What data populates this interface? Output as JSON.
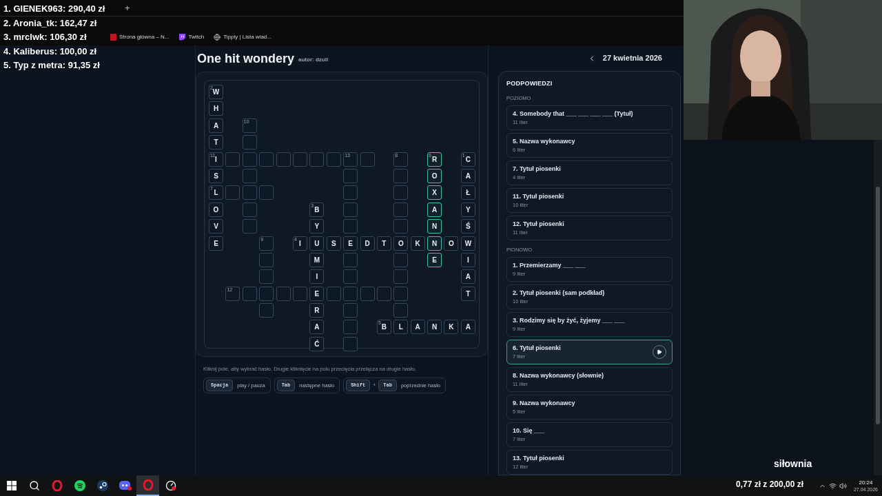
{
  "overlay_leaderboard": [
    "1. GIENEK963: 290,40 zł",
    "2. Aronia_tk: 162,47 zł",
    "3. mrclwk: 106,30 zł",
    "4. Kaliberus: 100,00 zł",
    "5. Typ z metra: 91,35 zł"
  ],
  "browser": {
    "new_tab": "+",
    "bookmarks": [
      {
        "kind": "site",
        "label": "Strona główna – N..."
      },
      {
        "kind": "twitch",
        "label": "Twitch"
      },
      {
        "kind": "tip",
        "label": "Tipply | Lista wiad..."
      }
    ]
  },
  "page": {
    "title": "One hit wondery",
    "author": "autor: dzuli",
    "date": "27 kwietnia 2026"
  },
  "board": {
    "grid": [
      [
        {
          "kind": "cell",
          "letter": "W",
          "number": "2",
          "highlighted": false
        },
        {
          "kind": "none"
        },
        {
          "kind": "none"
        },
        {
          "kind": "none"
        },
        {
          "kind": "none"
        },
        {
          "kind": "none"
        },
        {
          "kind": "none"
        },
        {
          "kind": "none"
        },
        {
          "kind": "none"
        },
        {
          "kind": "none"
        },
        {
          "kind": "none"
        },
        {
          "kind": "none"
        },
        {
          "kind": "none"
        },
        {
          "kind": "none"
        },
        {
          "kind": "none"
        },
        {
          "kind": "none"
        }
      ],
      [
        {
          "kind": "cell",
          "letter": "H",
          "highlighted": false
        },
        {
          "kind": "none"
        },
        {
          "kind": "none"
        },
        {
          "kind": "none"
        },
        {
          "kind": "none"
        },
        {
          "kind": "none"
        },
        {
          "kind": "none"
        },
        {
          "kind": "none"
        },
        {
          "kind": "none"
        },
        {
          "kind": "none"
        },
        {
          "kind": "none"
        },
        {
          "kind": "none"
        },
        {
          "kind": "none"
        },
        {
          "kind": "none"
        },
        {
          "kind": "none"
        },
        {
          "kind": "none"
        }
      ],
      [
        {
          "kind": "cell",
          "letter": "A",
          "highlighted": false
        },
        {
          "kind": "none"
        },
        {
          "kind": "cell",
          "number": "10",
          "highlighted": false
        },
        {
          "kind": "none"
        },
        {
          "kind": "none"
        },
        {
          "kind": "none"
        },
        {
          "kind": "none"
        },
        {
          "kind": "none"
        },
        {
          "kind": "none"
        },
        {
          "kind": "none"
        },
        {
          "kind": "none"
        },
        {
          "kind": "none"
        },
        {
          "kind": "none"
        },
        {
          "kind": "none"
        },
        {
          "kind": "none"
        },
        {
          "kind": "none"
        }
      ],
      [
        {
          "kind": "cell",
          "letter": "T",
          "highlighted": false
        },
        {
          "kind": "none"
        },
        {
          "kind": "cell",
          "highlighted": false
        },
        {
          "kind": "none"
        },
        {
          "kind": "none"
        },
        {
          "kind": "none"
        },
        {
          "kind": "none"
        },
        {
          "kind": "none"
        },
        {
          "kind": "none"
        },
        {
          "kind": "none"
        },
        {
          "kind": "none"
        },
        {
          "kind": "none"
        },
        {
          "kind": "none"
        },
        {
          "kind": "none"
        },
        {
          "kind": "none"
        },
        {
          "kind": "none"
        }
      ],
      [
        {
          "kind": "cell",
          "letter": "I",
          "number": "11",
          "highlighted": false
        },
        {
          "kind": "cell",
          "highlighted": false
        },
        {
          "kind": "cell",
          "highlighted": false
        },
        {
          "kind": "cell",
          "highlighted": false
        },
        {
          "kind": "cell",
          "highlighted": false
        },
        {
          "kind": "cell",
          "highlighted": false
        },
        {
          "kind": "cell",
          "highlighted": false
        },
        {
          "kind": "cell",
          "highlighted": false
        },
        {
          "kind": "cell",
          "number": "13",
          "highlighted": false
        },
        {
          "kind": "cell",
          "highlighted": false
        },
        {
          "kind": "none"
        },
        {
          "kind": "cell",
          "number": "8",
          "highlighted": false
        },
        {
          "kind": "none"
        },
        {
          "kind": "cell",
          "letter": "R",
          "number": "6",
          "highlighted": true
        },
        {
          "kind": "none"
        },
        {
          "kind": "cell",
          "letter": "C",
          "number": "1",
          "highlighted": false
        }
      ],
      [
        {
          "kind": "cell",
          "letter": "S",
          "highlighted": false
        },
        {
          "kind": "none"
        },
        {
          "kind": "cell",
          "highlighted": false
        },
        {
          "kind": "none"
        },
        {
          "kind": "none"
        },
        {
          "kind": "none"
        },
        {
          "kind": "none"
        },
        {
          "kind": "none"
        },
        {
          "kind": "cell",
          "highlighted": false
        },
        {
          "kind": "none"
        },
        {
          "kind": "none"
        },
        {
          "kind": "cell",
          "highlighted": false
        },
        {
          "kind": "none"
        },
        {
          "kind": "cell",
          "letter": "O",
          "highlighted": true
        },
        {
          "kind": "none"
        },
        {
          "kind": "cell",
          "letter": "A",
          "highlighted": false
        }
      ],
      [
        {
          "kind": "cell",
          "letter": "L",
          "number": "7",
          "highlighted": false
        },
        {
          "kind": "cell",
          "highlighted": false
        },
        {
          "kind": "cell",
          "highlighted": false
        },
        {
          "kind": "cell",
          "highlighted": false
        },
        {
          "kind": "none"
        },
        {
          "kind": "none"
        },
        {
          "kind": "none"
        },
        {
          "kind": "none"
        },
        {
          "kind": "cell",
          "highlighted": false
        },
        {
          "kind": "none"
        },
        {
          "kind": "none"
        },
        {
          "kind": "cell",
          "highlighted": false
        },
        {
          "kind": "none"
        },
        {
          "kind": "cell",
          "letter": "X",
          "highlighted": true
        },
        {
          "kind": "none"
        },
        {
          "kind": "cell",
          "letter": "Ł",
          "highlighted": false
        }
      ],
      [
        {
          "kind": "cell",
          "letter": "O",
          "highlighted": false
        },
        {
          "kind": "none"
        },
        {
          "kind": "cell",
          "highlighted": false
        },
        {
          "kind": "none"
        },
        {
          "kind": "none"
        },
        {
          "kind": "none"
        },
        {
          "kind": "cell",
          "letter": "B",
          "number": "3",
          "highlighted": false
        },
        {
          "kind": "none"
        },
        {
          "kind": "cell",
          "highlighted": false
        },
        {
          "kind": "none"
        },
        {
          "kind": "none"
        },
        {
          "kind": "cell",
          "highlighted": false
        },
        {
          "kind": "none"
        },
        {
          "kind": "cell",
          "letter": "A",
          "highlighted": true
        },
        {
          "kind": "none"
        },
        {
          "kind": "cell",
          "letter": "Y",
          "highlighted": false
        }
      ],
      [
        {
          "kind": "cell",
          "letter": "V",
          "highlighted": false
        },
        {
          "kind": "none"
        },
        {
          "kind": "cell",
          "highlighted": false
        },
        {
          "kind": "none"
        },
        {
          "kind": "none"
        },
        {
          "kind": "none"
        },
        {
          "kind": "cell",
          "letter": "Y",
          "highlighted": false
        },
        {
          "kind": "none"
        },
        {
          "kind": "cell",
          "highlighted": false
        },
        {
          "kind": "none"
        },
        {
          "kind": "none"
        },
        {
          "kind": "cell",
          "highlighted": false
        },
        {
          "kind": "none"
        },
        {
          "kind": "cell",
          "letter": "N",
          "highlighted": true
        },
        {
          "kind": "none"
        },
        {
          "kind": "cell",
          "letter": "Ś",
          "highlighted": false
        }
      ],
      [
        {
          "kind": "cell",
          "letter": "E",
          "highlighted": false
        },
        {
          "kind": "none"
        },
        {
          "kind": "none"
        },
        {
          "kind": "cell",
          "number": "9",
          "highlighted": false
        },
        {
          "kind": "none"
        },
        {
          "kind": "cell",
          "letter": "I",
          "number": "4",
          "highlighted": false
        },
        {
          "kind": "cell",
          "letter": "U",
          "highlighted": false
        },
        {
          "kind": "cell",
          "letter": "S",
          "highlighted": false
        },
        {
          "kind": "cell",
          "letter": "E",
          "highlighted": false
        },
        {
          "kind": "cell",
          "letter": "D",
          "highlighted": false
        },
        {
          "kind": "cell",
          "letter": "T",
          "highlighted": false
        },
        {
          "kind": "cell",
          "letter": "O",
          "highlighted": false
        },
        {
          "kind": "cell",
          "letter": "K",
          "highlighted": false
        },
        {
          "kind": "cell",
          "letter": "N",
          "highlighted": true
        },
        {
          "kind": "cell",
          "letter": "O",
          "highlighted": false
        },
        {
          "kind": "cell",
          "letter": "W",
          "highlighted": false
        }
      ],
      [
        {
          "kind": "none"
        },
        {
          "kind": "none"
        },
        {
          "kind": "none"
        },
        {
          "kind": "cell",
          "highlighted": false
        },
        {
          "kind": "none"
        },
        {
          "kind": "none"
        },
        {
          "kind": "cell",
          "letter": "M",
          "highlighted": false
        },
        {
          "kind": "none"
        },
        {
          "kind": "cell",
          "highlighted": false
        },
        {
          "kind": "none"
        },
        {
          "kind": "none"
        },
        {
          "kind": "cell",
          "highlighted": false
        },
        {
          "kind": "none"
        },
        {
          "kind": "cell",
          "letter": "E",
          "highlighted": true
        },
        {
          "kind": "none"
        },
        {
          "kind": "cell",
          "letter": "I",
          "highlighted": false
        }
      ],
      [
        {
          "kind": "none"
        },
        {
          "kind": "none"
        },
        {
          "kind": "none"
        },
        {
          "kind": "cell",
          "highlighted": false
        },
        {
          "kind": "none"
        },
        {
          "kind": "none"
        },
        {
          "kind": "cell",
          "letter": "I",
          "highlighted": false
        },
        {
          "kind": "none"
        },
        {
          "kind": "cell",
          "highlighted": false
        },
        {
          "kind": "none"
        },
        {
          "kind": "none"
        },
        {
          "kind": "cell",
          "highlighted": false
        },
        {
          "kind": "none"
        },
        {
          "kind": "none"
        },
        {
          "kind": "none"
        },
        {
          "kind": "cell",
          "letter": "A",
          "highlighted": false
        }
      ],
      [
        {
          "kind": "none"
        },
        {
          "kind": "cell",
          "number": "12",
          "highlighted": false
        },
        {
          "kind": "cell",
          "highlighted": false
        },
        {
          "kind": "cell",
          "highlighted": false
        },
        {
          "kind": "cell",
          "highlighted": false
        },
        {
          "kind": "cell",
          "highlighted": false
        },
        {
          "kind": "cell",
          "letter": "E",
          "highlighted": false
        },
        {
          "kind": "cell",
          "highlighted": false
        },
        {
          "kind": "cell",
          "highlighted": false
        },
        {
          "kind": "cell",
          "highlighted": false
        },
        {
          "kind": "cell",
          "highlighted": false
        },
        {
          "kind": "cell",
          "highlighted": false
        },
        {
          "kind": "none"
        },
        {
          "kind": "none"
        },
        {
          "kind": "none"
        },
        {
          "kind": "cell",
          "letter": "T",
          "highlighted": false
        }
      ],
      [
        {
          "kind": "none"
        },
        {
          "kind": "none"
        },
        {
          "kind": "none"
        },
        {
          "kind": "cell",
          "highlighted": false
        },
        {
          "kind": "none"
        },
        {
          "kind": "none"
        },
        {
          "kind": "cell",
          "letter": "R",
          "highlighted": false
        },
        {
          "kind": "none"
        },
        {
          "kind": "cell",
          "highlighted": false
        },
        {
          "kind": "none"
        },
        {
          "kind": "none"
        },
        {
          "kind": "cell",
          "highlighted": false
        },
        {
          "kind": "none"
        },
        {
          "kind": "none"
        },
        {
          "kind": "none"
        },
        {
          "kind": "none"
        }
      ],
      [
        {
          "kind": "none"
        },
        {
          "kind": "none"
        },
        {
          "kind": "none"
        },
        {
          "kind": "none"
        },
        {
          "kind": "none"
        },
        {
          "kind": "none"
        },
        {
          "kind": "cell",
          "letter": "A",
          "highlighted": false
        },
        {
          "kind": "none"
        },
        {
          "kind": "cell",
          "highlighted": false
        },
        {
          "kind": "none"
        },
        {
          "kind": "cell",
          "letter": "B",
          "number": "5",
          "highlighted": false
        },
        {
          "kind": "cell",
          "letter": "L",
          "highlighted": false
        },
        {
          "kind": "cell",
          "letter": "A",
          "highlighted": false
        },
        {
          "kind": "cell",
          "letter": "N",
          "highlighted": false
        },
        {
          "kind": "cell",
          "letter": "K",
          "highlighted": false
        },
        {
          "kind": "cell",
          "letter": "A",
          "highlighted": false
        }
      ],
      [
        {
          "kind": "none"
        },
        {
          "kind": "none"
        },
        {
          "kind": "none"
        },
        {
          "kind": "none"
        },
        {
          "kind": "none"
        },
        {
          "kind": "none"
        },
        {
          "kind": "cell",
          "letter": "Ć",
          "highlighted": false
        },
        {
          "kind": "none"
        },
        {
          "kind": "cell",
          "highlighted": false
        },
        {
          "kind": "none"
        },
        {
          "kind": "none"
        },
        {
          "kind": "none"
        },
        {
          "kind": "none"
        },
        {
          "kind": "none"
        },
        {
          "kind": "none"
        },
        {
          "kind": "none"
        }
      ]
    ]
  },
  "instructions": "Kliknij pole, aby wybrać hasło. Drugie kliknięcie na polu przecięcia przełącza na drugie hasło.",
  "shortcuts": [
    {
      "keys": [
        "Spacja"
      ],
      "label": "play / pauza"
    },
    {
      "keys": [
        "Tab"
      ],
      "label": "następne hasło"
    },
    {
      "keys": [
        "Shift",
        "Tab"
      ],
      "joiner": "+",
      "label": "poprzednie hasło"
    }
  ],
  "hints": {
    "title": "PODPOWIEDZI",
    "sections": [
      {
        "heading": "POZIOMO",
        "clues": [
          {
            "text": "4. Somebody that ___ ___ ___ ___ (Tytuł)",
            "count": "11 liter",
            "selected": false
          },
          {
            "text": "5. Nazwa wykonawcy",
            "count": "6 liter",
            "selected": false
          },
          {
            "text": "7. Tytuł piosenki",
            "count": "4 liter",
            "selected": false
          },
          {
            "text": "11. Tytuł piosenki",
            "count": "10 liter",
            "selected": false
          },
          {
            "text": "12. Tytuł piosenki",
            "count": "11 liter",
            "selected": false
          }
        ]
      },
      {
        "heading": "PIONOWO",
        "clues": [
          {
            "text": "1. Przemierzamy ___ ___",
            "count": "9 liter",
            "selected": false
          },
          {
            "text": "2. Tytuł piosenki (sam podkład)",
            "count": "10 liter",
            "selected": false
          },
          {
            "text": "3. Rodzimy się by żyć, żyjemy ___ ___",
            "count": "9 liter",
            "selected": false
          },
          {
            "text": "6. Tytuł piosenki",
            "count": "7 liter",
            "selected": true
          },
          {
            "text": "8. Nazwa wykonawcy (słownie)",
            "count": "11 liter",
            "selected": false
          },
          {
            "text": "9. Nazwa wykonawcy",
            "count": "5 liter",
            "selected": false
          },
          {
            "text": "10. Się ___",
            "count": "7 liter",
            "selected": false
          },
          {
            "text": "13. Tytuł piosenki",
            "count": "12 liter",
            "selected": false
          }
        ]
      }
    ]
  },
  "stream_overlay": {
    "label": "siłownia",
    "goal": "0,77 zł z 200,00 zł"
  },
  "taskbar": {
    "apps": [
      {
        "kind": "windows",
        "active": false
      },
      {
        "kind": "search",
        "active": false
      },
      {
        "kind": "opera",
        "active": false
      },
      {
        "kind": "spotify",
        "active": false
      },
      {
        "kind": "steam",
        "active": false
      },
      {
        "kind": "discord",
        "active": false
      },
      {
        "kind": "opera",
        "active": true
      },
      {
        "kind": "gauge",
        "active": false
      }
    ],
    "time": "20:24",
    "date": "27.04.2026"
  }
}
